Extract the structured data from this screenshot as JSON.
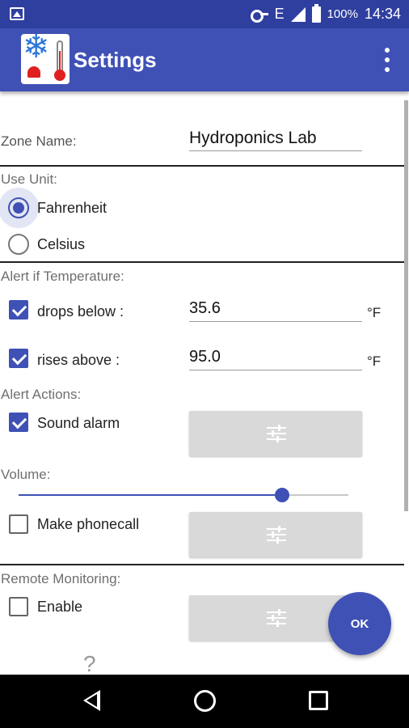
{
  "status_bar": {
    "network": "E",
    "battery": "100%",
    "time": "14:34"
  },
  "app_bar": {
    "title": "Settings"
  },
  "zone": {
    "label": "Zone Name:",
    "value": "Hydroponics Lab"
  },
  "unit": {
    "label": "Use Unit:",
    "fahrenheit": "Fahrenheit",
    "celsius": "Celsius",
    "selected": "Fahrenheit"
  },
  "alert": {
    "label": "Alert if Temperature:",
    "drops_label": "drops below :",
    "drops_value": "35.6",
    "drops_checked": true,
    "rises_label": "rises above :",
    "rises_value": "95.0",
    "rises_checked": true,
    "unit": "°F"
  },
  "actions": {
    "label": "Alert Actions:",
    "sound_label": "Sound alarm",
    "sound_checked": true,
    "volume_label": "Volume:",
    "volume_level": 0.8,
    "phone_label": "Make phonecall",
    "phone_checked": false
  },
  "remote": {
    "label": "Remote Monitoring:",
    "enable_label": "Enable",
    "enable_checked": false
  },
  "fab": {
    "label": "OK"
  },
  "colors": {
    "primary": "#3f51b5",
    "status": "#2f3fa0"
  }
}
